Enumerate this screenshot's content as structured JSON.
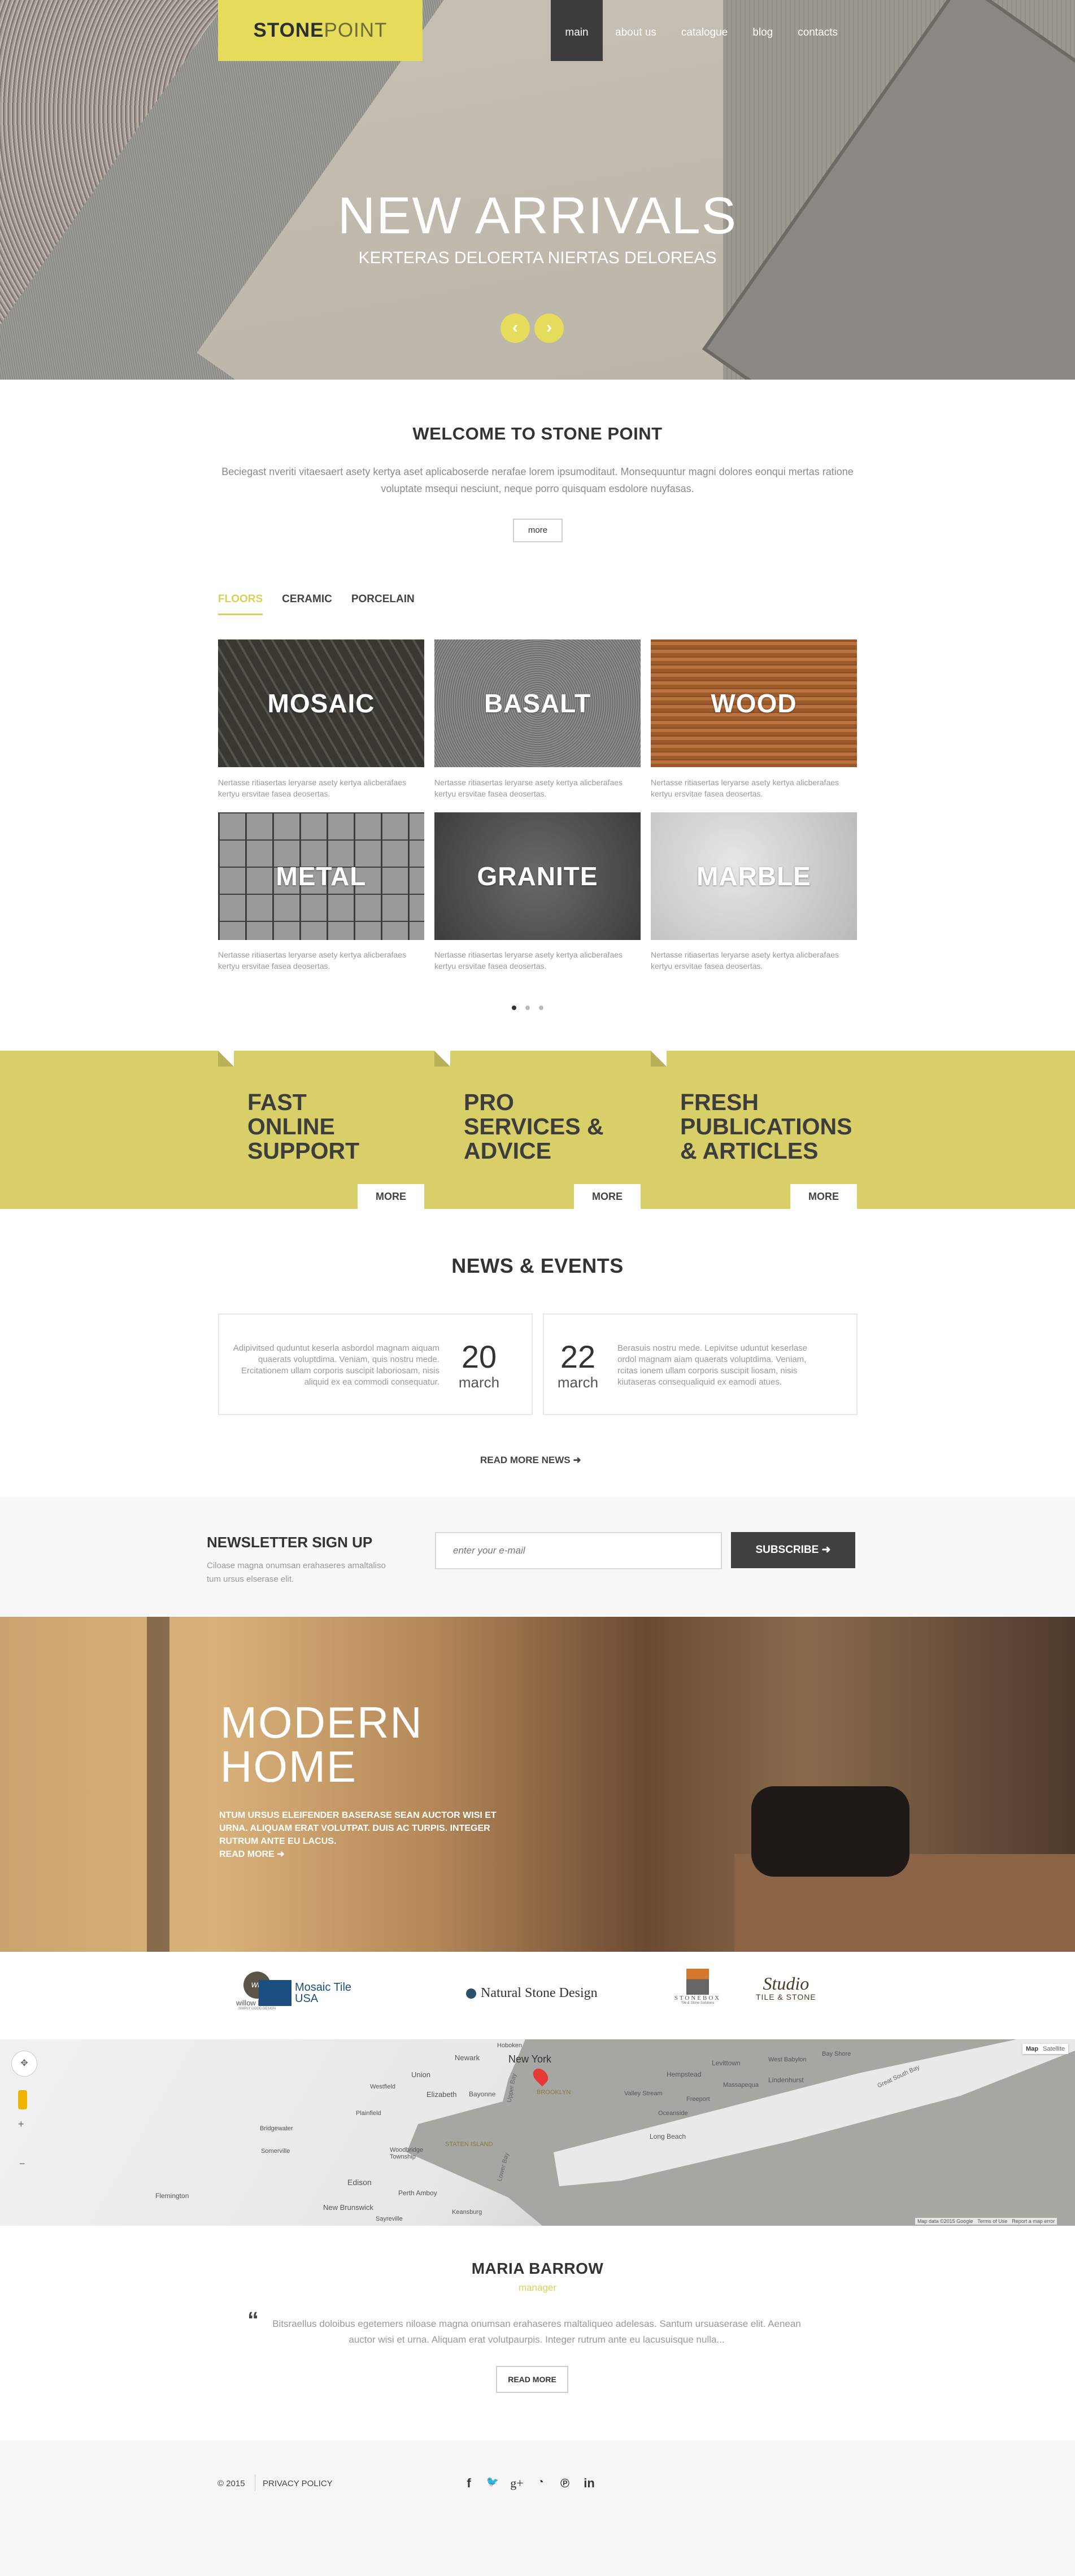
{
  "colors": {
    "accent": "#e4dc5a",
    "band": "#d8cf68",
    "dark": "#3c3c3c"
  },
  "header": {
    "logo_part1": "STONE",
    "logo_part2": "POINT",
    "nav": [
      {
        "label": "main",
        "active": true
      },
      {
        "label": "about us"
      },
      {
        "label": "catalogue"
      },
      {
        "label": "blog"
      },
      {
        "label": "contacts"
      }
    ]
  },
  "hero": {
    "title": "NEW ARRIVALS",
    "subtitle": "KERTERAS DELOERTA NIERTAS DELOREAS",
    "prev_icon": "chevron-left",
    "next_icon": "chevron-right"
  },
  "welcome": {
    "title": "WELCOME TO STONE POINT",
    "text": "Beciegast nveriti vitaesaert asety kertya aset aplicaboserde nerafae lorem ipsumoditaut. Monsequuntur magni dolores eonqui mertas ratione voluptate msequi nesciunt, neque porro quisquam esdolore nuyfasas.",
    "more": "more"
  },
  "catalog": {
    "tabs": [
      "FLOORS",
      "CERAMIC",
      "PORCELAIN"
    ],
    "active_tab": 0,
    "items": [
      {
        "name": "MOSAIC",
        "desc": "Nertasse ritiasertas leryarse asety kertya alicberafaes kertyu ersvitae fasea deosertas."
      },
      {
        "name": "BASALT",
        "desc": "Nertasse ritiasertas leryarse asety kertya alicberafaes kertyu ersvitae fasea deosertas."
      },
      {
        "name": "WOOD",
        "desc": "Nertasse ritiasertas leryarse asety kertya alicberafaes kertyu ersvitae fasea deosertas."
      },
      {
        "name": "METAL",
        "desc": "Nertasse ritiasertas leryarse asety kertya alicberafaes kertyu ersvitae fasea deosertas."
      },
      {
        "name": "GRANITE",
        "desc": "Nertasse ritiasertas leryarse asety kertya alicberafaes kertyu ersvitae fasea deosertas."
      },
      {
        "name": "MARBLE",
        "desc": "Nertasse ritiasertas leryarse asety kertya alicberafaes kertyu ersvitae fasea deosertas."
      }
    ],
    "pages": 3,
    "current_page": 1
  },
  "features": [
    {
      "title": [
        "FAST",
        "ONLINE",
        "SUPPORT"
      ],
      "more": "MORE"
    },
    {
      "title": [
        "PRO",
        "SERVICES &",
        "ADVICE"
      ],
      "more": "MORE"
    },
    {
      "title": [
        "FRESH",
        "PUBLICATIONS",
        "& ARTICLES"
      ],
      "more": "MORE"
    }
  ],
  "news": {
    "title": "NEWS & EVENTS",
    "items": [
      {
        "text": "Adipivitsed quduntut keserla asbordol magnam aiquam quaerats voluptdima. Veniam, quis nostru mede. Ercitationem ullam corporis suscipit laboriosam, nisis aliquid ex ea commodi consequatur.",
        "day": "20",
        "month": "march"
      },
      {
        "text": "Berasuis nostru mede. Lepivitse uduntut keserlase ordol magnam aiam quaerats voluptdima. Veniam, rcitas ionem ullam corporis suscipit liosam, nisis kiutaseras consequaliquid ex eamodi atues.",
        "day": "22",
        "month": "march"
      }
    ],
    "read_more": "READ MORE NEWS"
  },
  "newsletter": {
    "title": "NEWSLETTER SIGN UP",
    "text": "Ciloase magna onumsan erahaseres amaltaliso tum ursus elserase elit.",
    "placeholder": "enter your e-mail",
    "button": "SUBSCRIBE"
  },
  "promo": {
    "title_line1": "MODERN",
    "title_line2": "HOME",
    "text": "NTUM URSUS ELEIFENDER BASERASE SEAN AUCTOR WISI ET URNA. ALIQUAM ERAT VOLUTPAT. DUIS AC TURPIS. INTEGER RUTRUM ANTE EU LACUS.",
    "read_more": "READ MORE"
  },
  "partners": [
    {
      "name": "willow house",
      "sub": "SIMPLY GOOD DESIGN",
      "mark": "wh"
    },
    {
      "name": "Mosaic Tile",
      "sub": "USA"
    },
    {
      "name": "Natural Stone Design"
    },
    {
      "name": "STONEBOX",
      "sub": "Tile & Stone Solutions"
    },
    {
      "name": "Studio",
      "sub": "TILE & STONE"
    }
  ],
  "map": {
    "type_buttons": [
      "Map",
      "Satellite"
    ],
    "active_type": "Map",
    "labels": [
      "New York",
      "Newark",
      "Hoboken",
      "BROOKLYN",
      "Elizabeth",
      "Bayonne",
      "Union",
      "STATEN ISLAND",
      "Edison",
      "New Brunswick",
      "Perth Amboy",
      "Flemington",
      "Somerville",
      "Bridgewater",
      "Hempstead",
      "Freeport",
      "Long Beach",
      "Levittown",
      "Lindenhurst",
      "Great South Bay",
      "Upper Bay",
      "Lower Bay",
      "Plainfield",
      "Westfield",
      "Woodbridge Township",
      "Sayreville",
      "Keansburg",
      "Oceanside",
      "Valley Stream",
      "Massapequa",
      "West Babylon",
      "Bay Shore"
    ],
    "footer": [
      "Map data ©2015 Google",
      "Terms of Use",
      "Report a map error"
    ]
  },
  "testimonial": {
    "name": "MARIA BARROW",
    "role": "manager",
    "quote": "Bitsraellus doloibus egetemers niloase magna onumsan erahaseres maltaliqueo adelesas. Santum ursuaserase elit. Aenean auctor wisi et urna. Aliquam erat volutpaurpis. Integer rutrum ante eu lacusuisque nulla...",
    "button": "READ MORE"
  },
  "footer": {
    "copyright": "© 2015",
    "privacy": "PRIVACY POLICY",
    "social": [
      "facebook",
      "twitter",
      "google-plus",
      "rss",
      "pinterest",
      "linkedin"
    ]
  }
}
